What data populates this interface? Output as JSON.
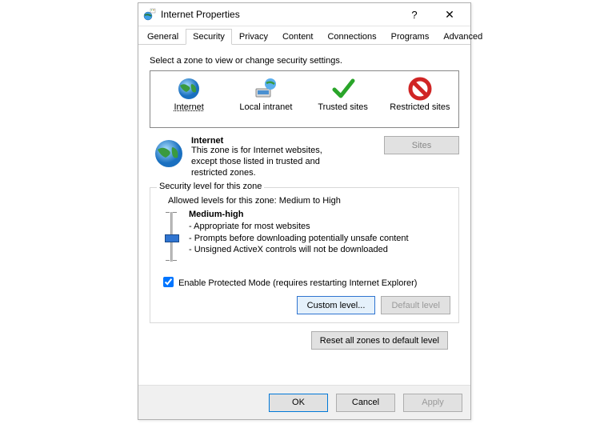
{
  "window": {
    "title": "Internet Properties"
  },
  "tabs": [
    "General",
    "Security",
    "Privacy",
    "Content",
    "Connections",
    "Programs",
    "Advanced"
  ],
  "activeTab": 1,
  "instruct": "Select a zone to view or change security settings.",
  "zones": [
    {
      "label": "Internet"
    },
    {
      "label": "Local intranet"
    },
    {
      "label": "Trusted sites"
    },
    {
      "label": "Restricted sites"
    }
  ],
  "selectedZone": 0,
  "zoneDetail": {
    "title": "Internet",
    "desc": "This zone is for Internet websites, except those listed in trusted and restricted zones.",
    "sitesLabel": "Sites"
  },
  "security": {
    "groupTitle": "Security level for this zone",
    "allowed": "Allowed levels for this zone: Medium to High",
    "level": "Medium-high",
    "lines": [
      "- Appropriate for most websites",
      "- Prompts before downloading potentially unsafe content",
      "- Unsigned ActiveX controls will not be downloaded"
    ],
    "protectedMode": "Enable Protected Mode (requires restarting Internet Explorer)",
    "protectedModeChecked": true,
    "customLabel": "Custom level...",
    "defaultLabel": "Default level"
  },
  "resetLabel": "Reset all zones to default level",
  "footer": {
    "ok": "OK",
    "cancel": "Cancel",
    "apply": "Apply"
  }
}
